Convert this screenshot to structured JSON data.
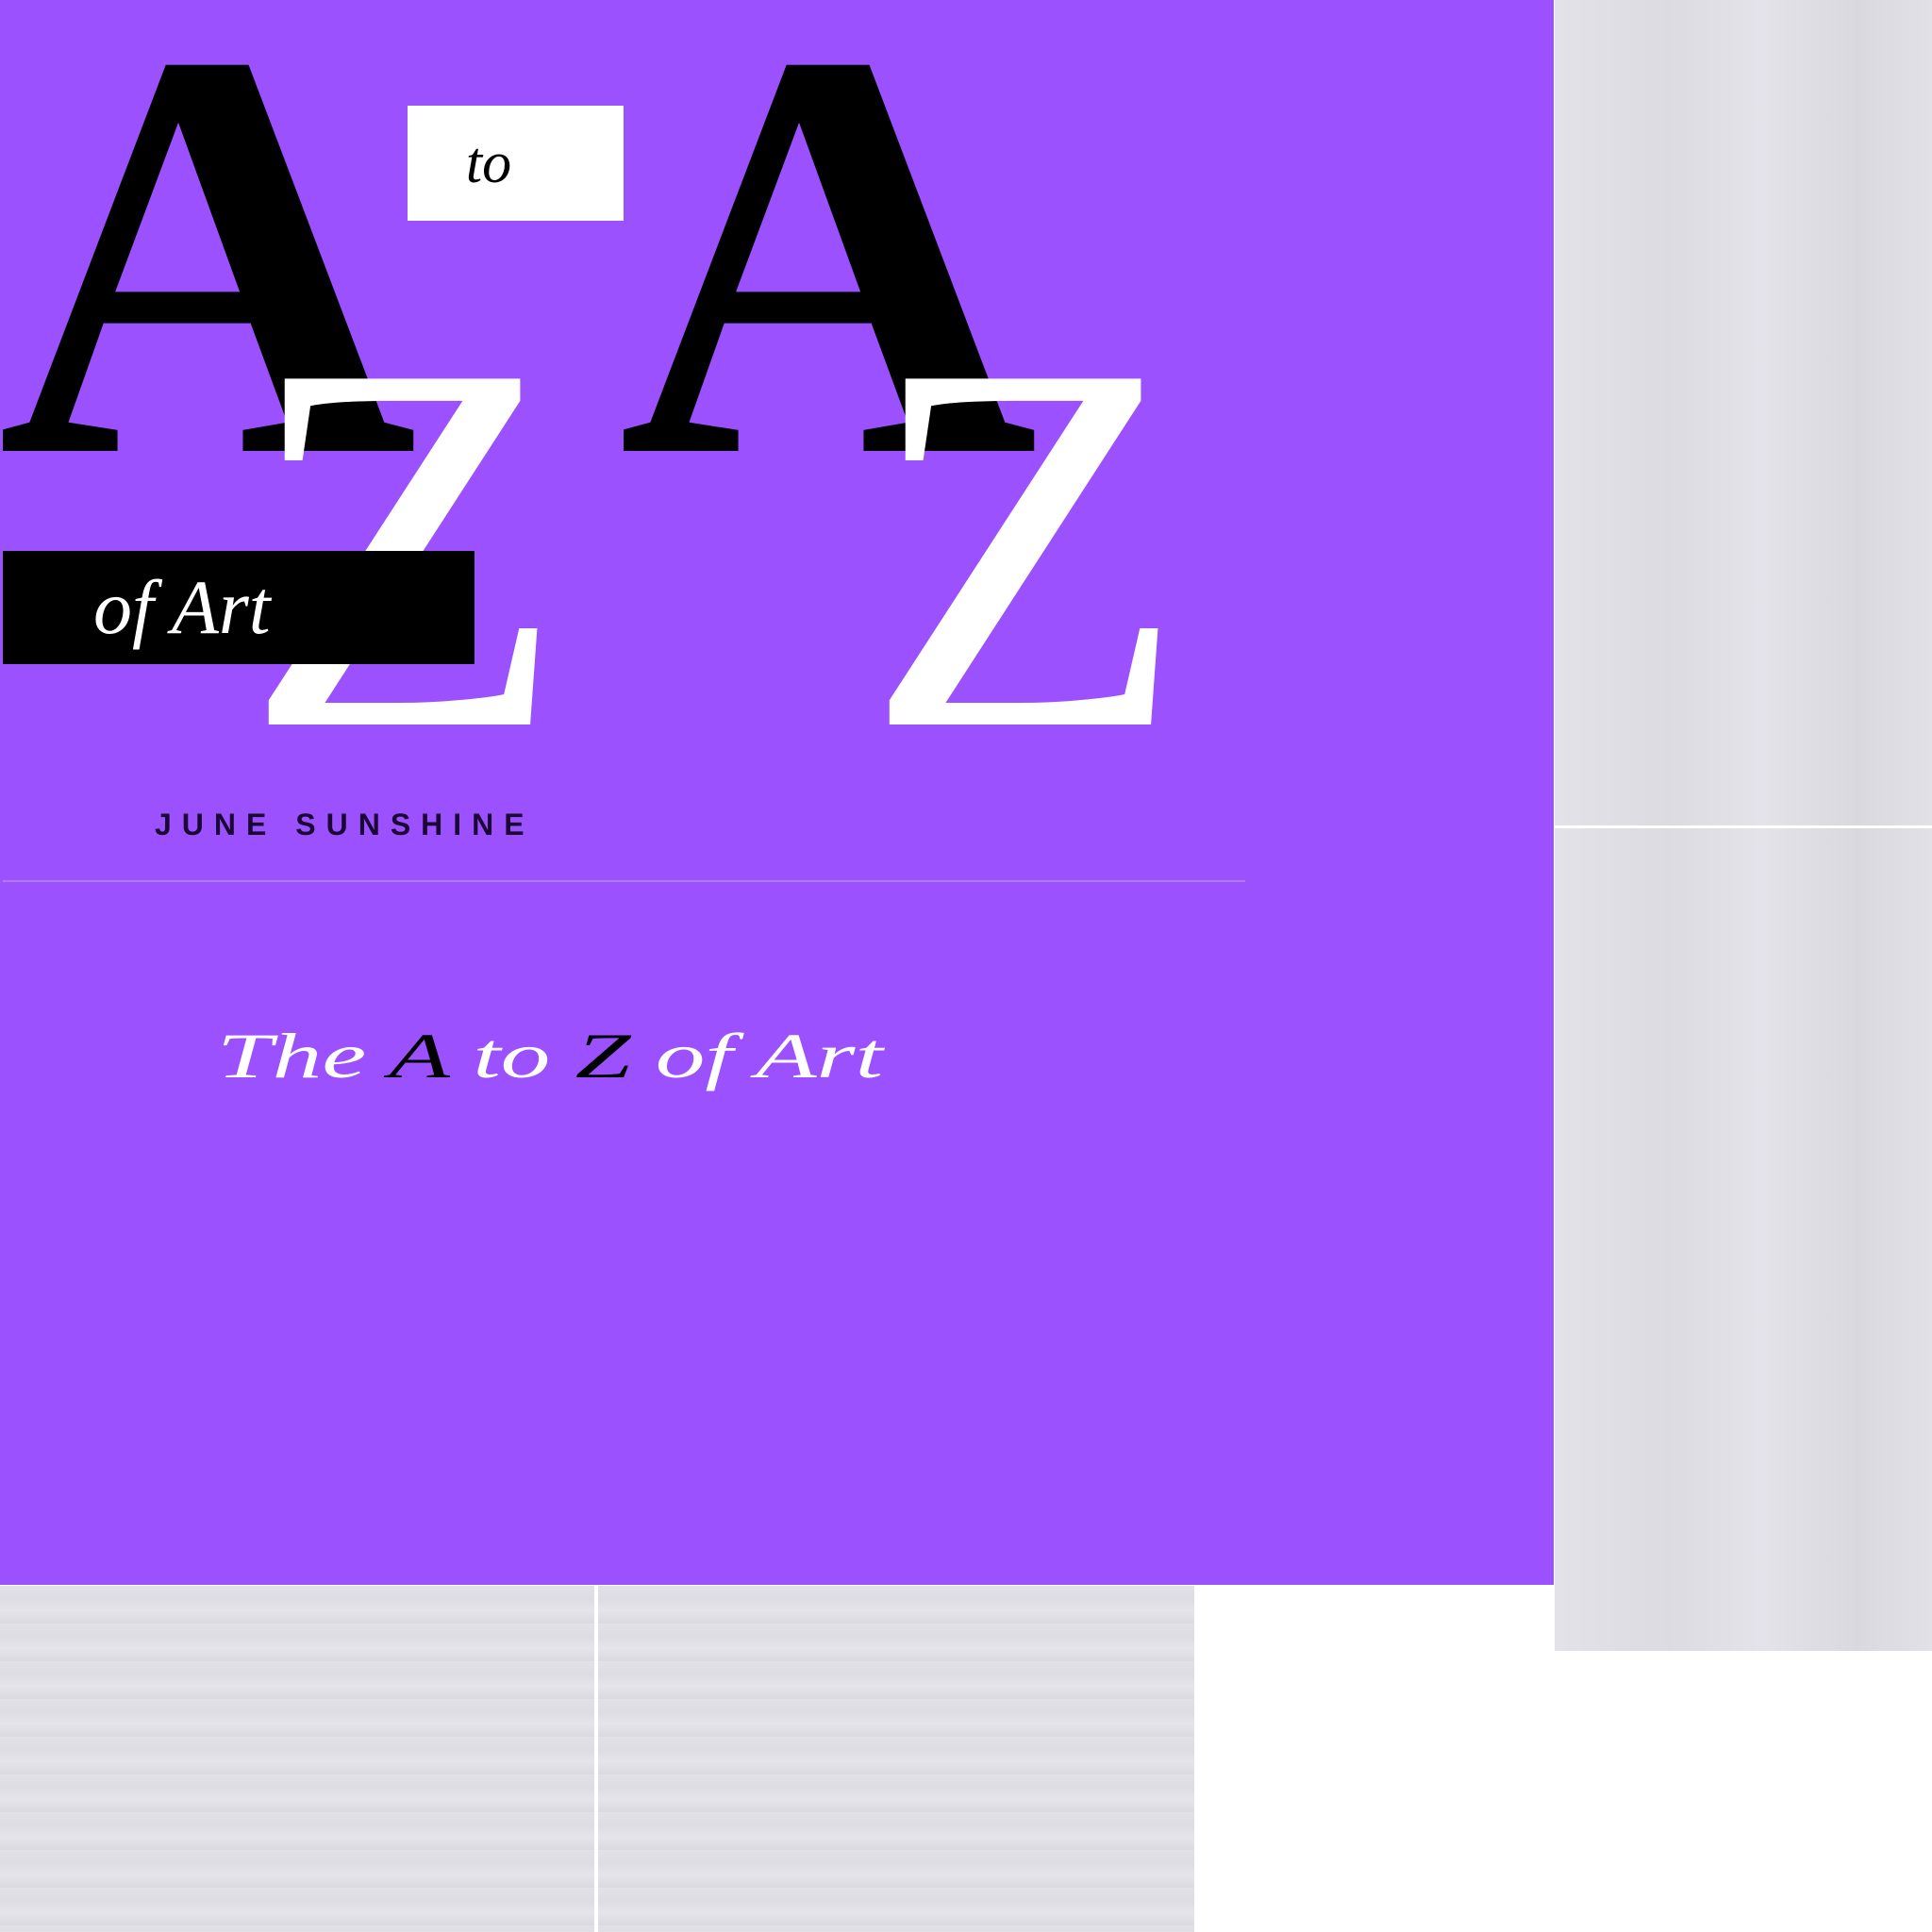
{
  "colors": {
    "background": "#9b51fd",
    "letter_a": "#000000",
    "letter_z": "#ffffff",
    "panel": "#e0dfe6"
  },
  "cover": {
    "letter_a": "A",
    "letter_z": "Z",
    "to": "to",
    "of_art": "of Art",
    "author": "JUNE SUNSHINE"
  },
  "subtitle": {
    "the": "The",
    "a": "A",
    "to": "to",
    "z": "Z",
    "of_art": "of Art"
  }
}
